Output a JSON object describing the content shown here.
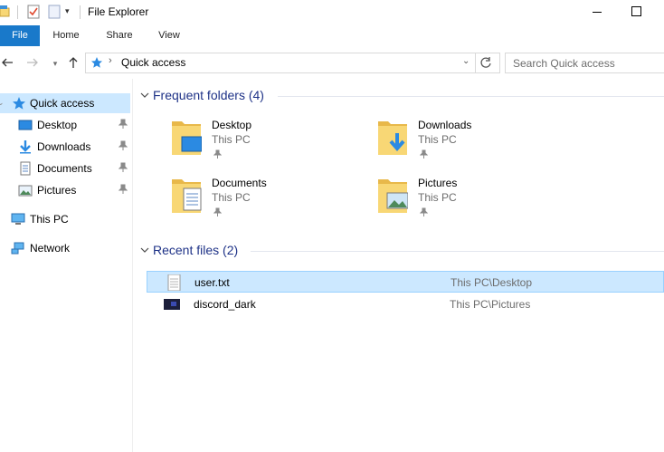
{
  "window": {
    "title": "File Explorer"
  },
  "ribbon": {
    "tabs": [
      "File",
      "Home",
      "Share",
      "View"
    ]
  },
  "address": {
    "crumb": "Quick access",
    "search_placeholder": "Search Quick access"
  },
  "nav": {
    "quick_access": "Quick access",
    "pinned": [
      "Desktop",
      "Downloads",
      "Documents",
      "Pictures"
    ],
    "this_pc": "This PC",
    "network": "Network"
  },
  "frequent": {
    "header": "Frequent folders (4)",
    "folders": [
      {
        "name": "Desktop",
        "location": "This PC",
        "icon": "desktop-folder-icon"
      },
      {
        "name": "Downloads",
        "location": "This PC",
        "icon": "downloads-folder-icon"
      },
      {
        "name": "Documents",
        "location": "This PC",
        "icon": "documents-folder-icon"
      },
      {
        "name": "Pictures",
        "location": "This PC",
        "icon": "pictures-folder-icon"
      }
    ]
  },
  "recent": {
    "header": "Recent files (2)",
    "files": [
      {
        "name": "user.txt",
        "location": "This PC\\Desktop",
        "icon": "text-file-icon",
        "selected": true
      },
      {
        "name": "discord_dark",
        "location": "This PC\\Pictures",
        "icon": "image-file-icon",
        "selected": false
      }
    ]
  },
  "colors": {
    "accent": "#1979ca",
    "selection": "#cce8ff",
    "group_header": "#1e3287",
    "folder": "#f8d775"
  }
}
